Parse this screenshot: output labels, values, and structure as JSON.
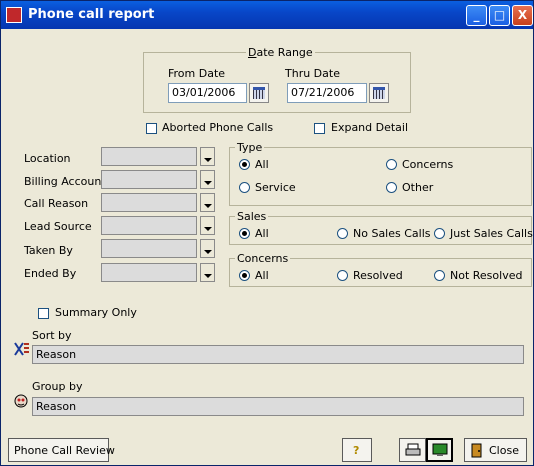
{
  "window": {
    "title": "Phone call report",
    "controls": [
      "_",
      "□",
      "X"
    ]
  },
  "date_range": {
    "title": "Date Range",
    "from_label": "From Date",
    "from_value": "03/01/2006",
    "thru_label": "Thru Date",
    "thru_value": "07/21/2006"
  },
  "checks": {
    "aborted": {
      "label": "Aborted Phone Calls",
      "checked": false
    },
    "expand": {
      "label": "Expand Detail",
      "checked": false
    },
    "summary": {
      "label": "Summary Only",
      "checked": false
    }
  },
  "filters": [
    {
      "label": "Location",
      "value": ""
    },
    {
      "label": "Billing Account",
      "value": ""
    },
    {
      "label": "Call Reason",
      "value": ""
    },
    {
      "label": "Lead Source",
      "value": ""
    },
    {
      "label": "Taken By",
      "value": ""
    },
    {
      "label": "Ended By",
      "value": ""
    }
  ],
  "type": {
    "title": "Type",
    "options": [
      "All",
      "Concerns",
      "Service",
      "Other"
    ],
    "selected": "All"
  },
  "sales": {
    "title": "Sales",
    "options": [
      "All",
      "No Sales Calls",
      "Just Sales Calls"
    ],
    "selected": "All"
  },
  "concerns": {
    "title": "Concerns",
    "options": [
      "All",
      "Resolved",
      "Not Resolved"
    ],
    "selected": "All"
  },
  "sort_by": {
    "label": "Sort by",
    "value": "Reason"
  },
  "group_by": {
    "label": "Group by",
    "value": "Reason"
  },
  "buttons": {
    "review": "Phone Call Review",
    "help": "?",
    "close": "Close"
  }
}
